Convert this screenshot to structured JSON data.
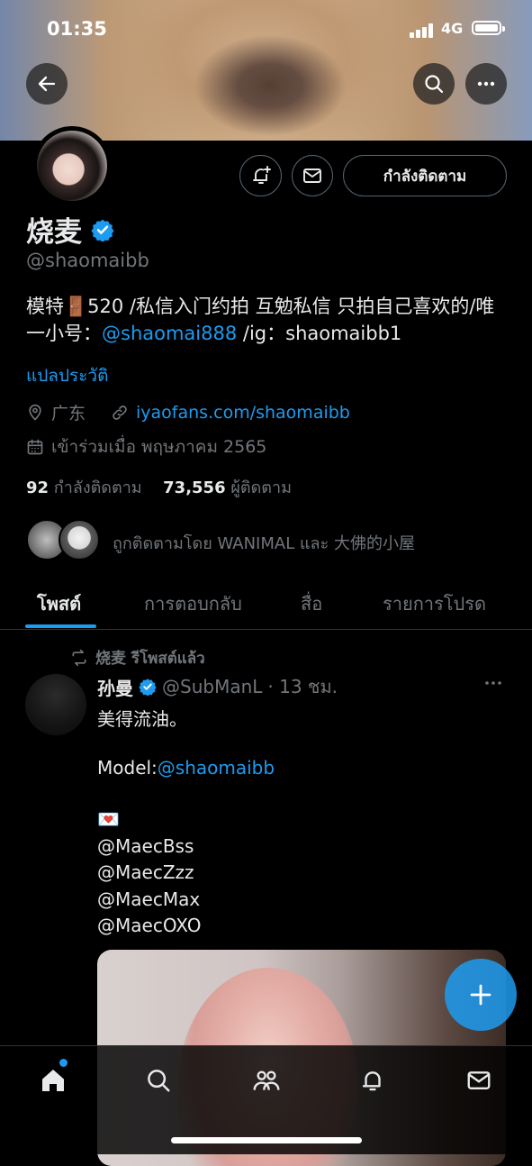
{
  "status": {
    "time": "01:35",
    "network": "4G"
  },
  "profile": {
    "name": "烧麦",
    "handle": "@shaomaibb",
    "bio_text": "模特🚪520 /私信入门约拍 互勉私信 只拍自己喜欢的/唯一小号：",
    "bio_mention": "@shaomai888",
    "bio_tail": " /ig：shaomaibb1",
    "translate": "แปลประวัติ",
    "location": "广东",
    "website": "iyaofans.com/shaomaibb",
    "joined": "เข้าร่วมเมื่อ พฤษภาคม 2565",
    "following_count": "92",
    "following_label": "กำลังติดตาม",
    "followers_count": "73,556",
    "followers_label": "ผู้ติดตาม",
    "followed_by": "ถูกติดตามโดย WANIMAL และ 大佛的小屋"
  },
  "actions": {
    "following_button": "กำลังติดตาม"
  },
  "tabs": [
    "โพสต์",
    "การตอบกลับ",
    "สื่อ",
    "รายการโปรด"
  ],
  "post": {
    "repost_label": "烧麦 รีโพสต์แล้ว",
    "author_name": "孙曼",
    "author_handle": "@SubManL",
    "time": "· 13 ชม.",
    "line1": "美得流油。",
    "model_prefix": "Model:",
    "model_mention": "@shaomaibb",
    "heart": "💌",
    "mentions": [
      "@MaecBss",
      "@MaecZzz",
      "@MaecMax",
      "@MaecOXO"
    ]
  },
  "colors": {
    "accent": "#1d9bf0",
    "muted": "#71767b",
    "text": "#e7e9ea",
    "border": "#536471"
  }
}
